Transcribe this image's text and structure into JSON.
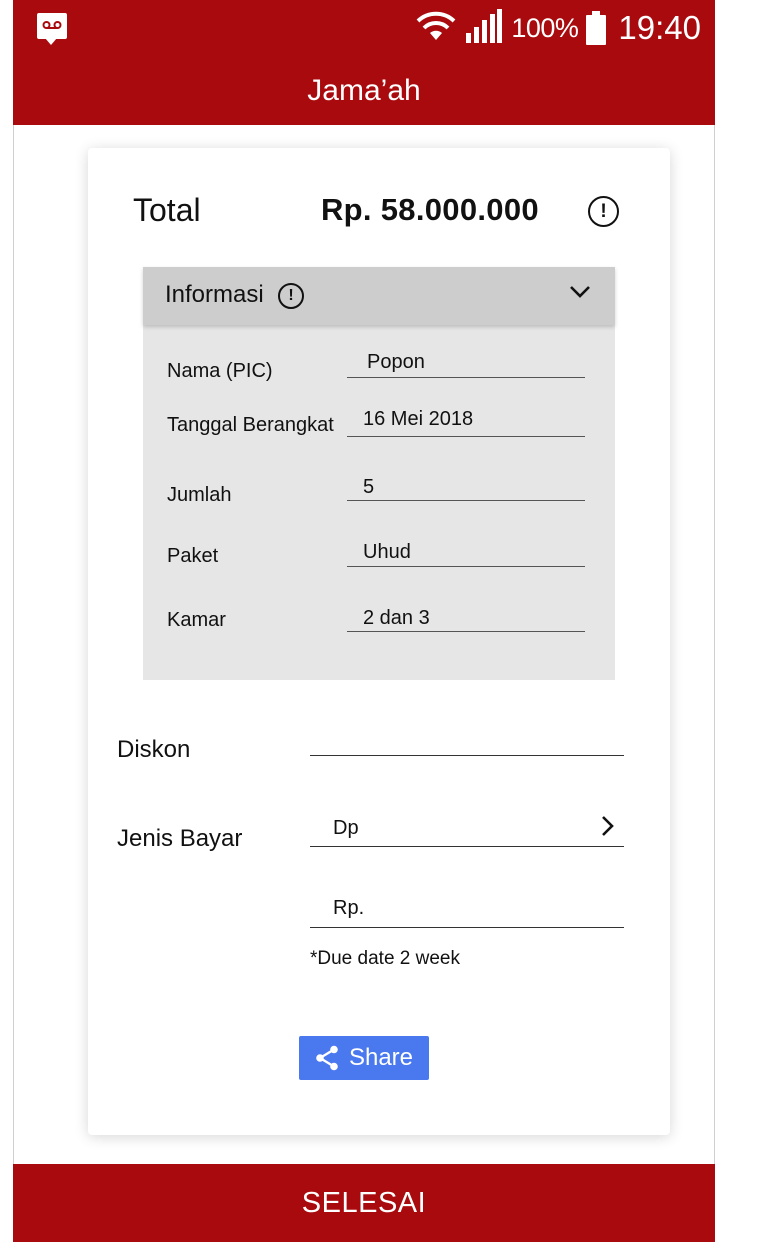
{
  "status_bar": {
    "battery_percent": "100%",
    "time": "19:40",
    "icons": [
      "voicemail-icon",
      "wifi-icon",
      "signal-icon",
      "battery-icon"
    ]
  },
  "app_bar": {
    "title": "Jama’ah"
  },
  "summary": {
    "total_label": "Total",
    "total_value": "Rp. 58.000.000"
  },
  "info_section": {
    "header": "Informasi",
    "rows": [
      {
        "label": "Nama (PIC)",
        "value": "Popon"
      },
      {
        "label": "Tanggal Berangkat",
        "value": "16 Mei 2018"
      },
      {
        "label": "Jumlah",
        "value": "5"
      },
      {
        "label": "Paket",
        "value": "Uhud"
      },
      {
        "label": "Kamar",
        "value": "2 dan 3"
      }
    ]
  },
  "discount": {
    "label": "Diskon",
    "value": ""
  },
  "payment": {
    "label": "Jenis Bayar",
    "type_value": "Dp",
    "amount_value": "Rp.",
    "due_note": "*Due date 2 week"
  },
  "share": {
    "label": "Share"
  },
  "footer": {
    "finish_label": "SELESAI"
  },
  "colors": {
    "primary": "#a90a0e",
    "share_button": "#4a78ef",
    "panel": "#e6e6e6",
    "panel_header": "#cdcdcd"
  }
}
